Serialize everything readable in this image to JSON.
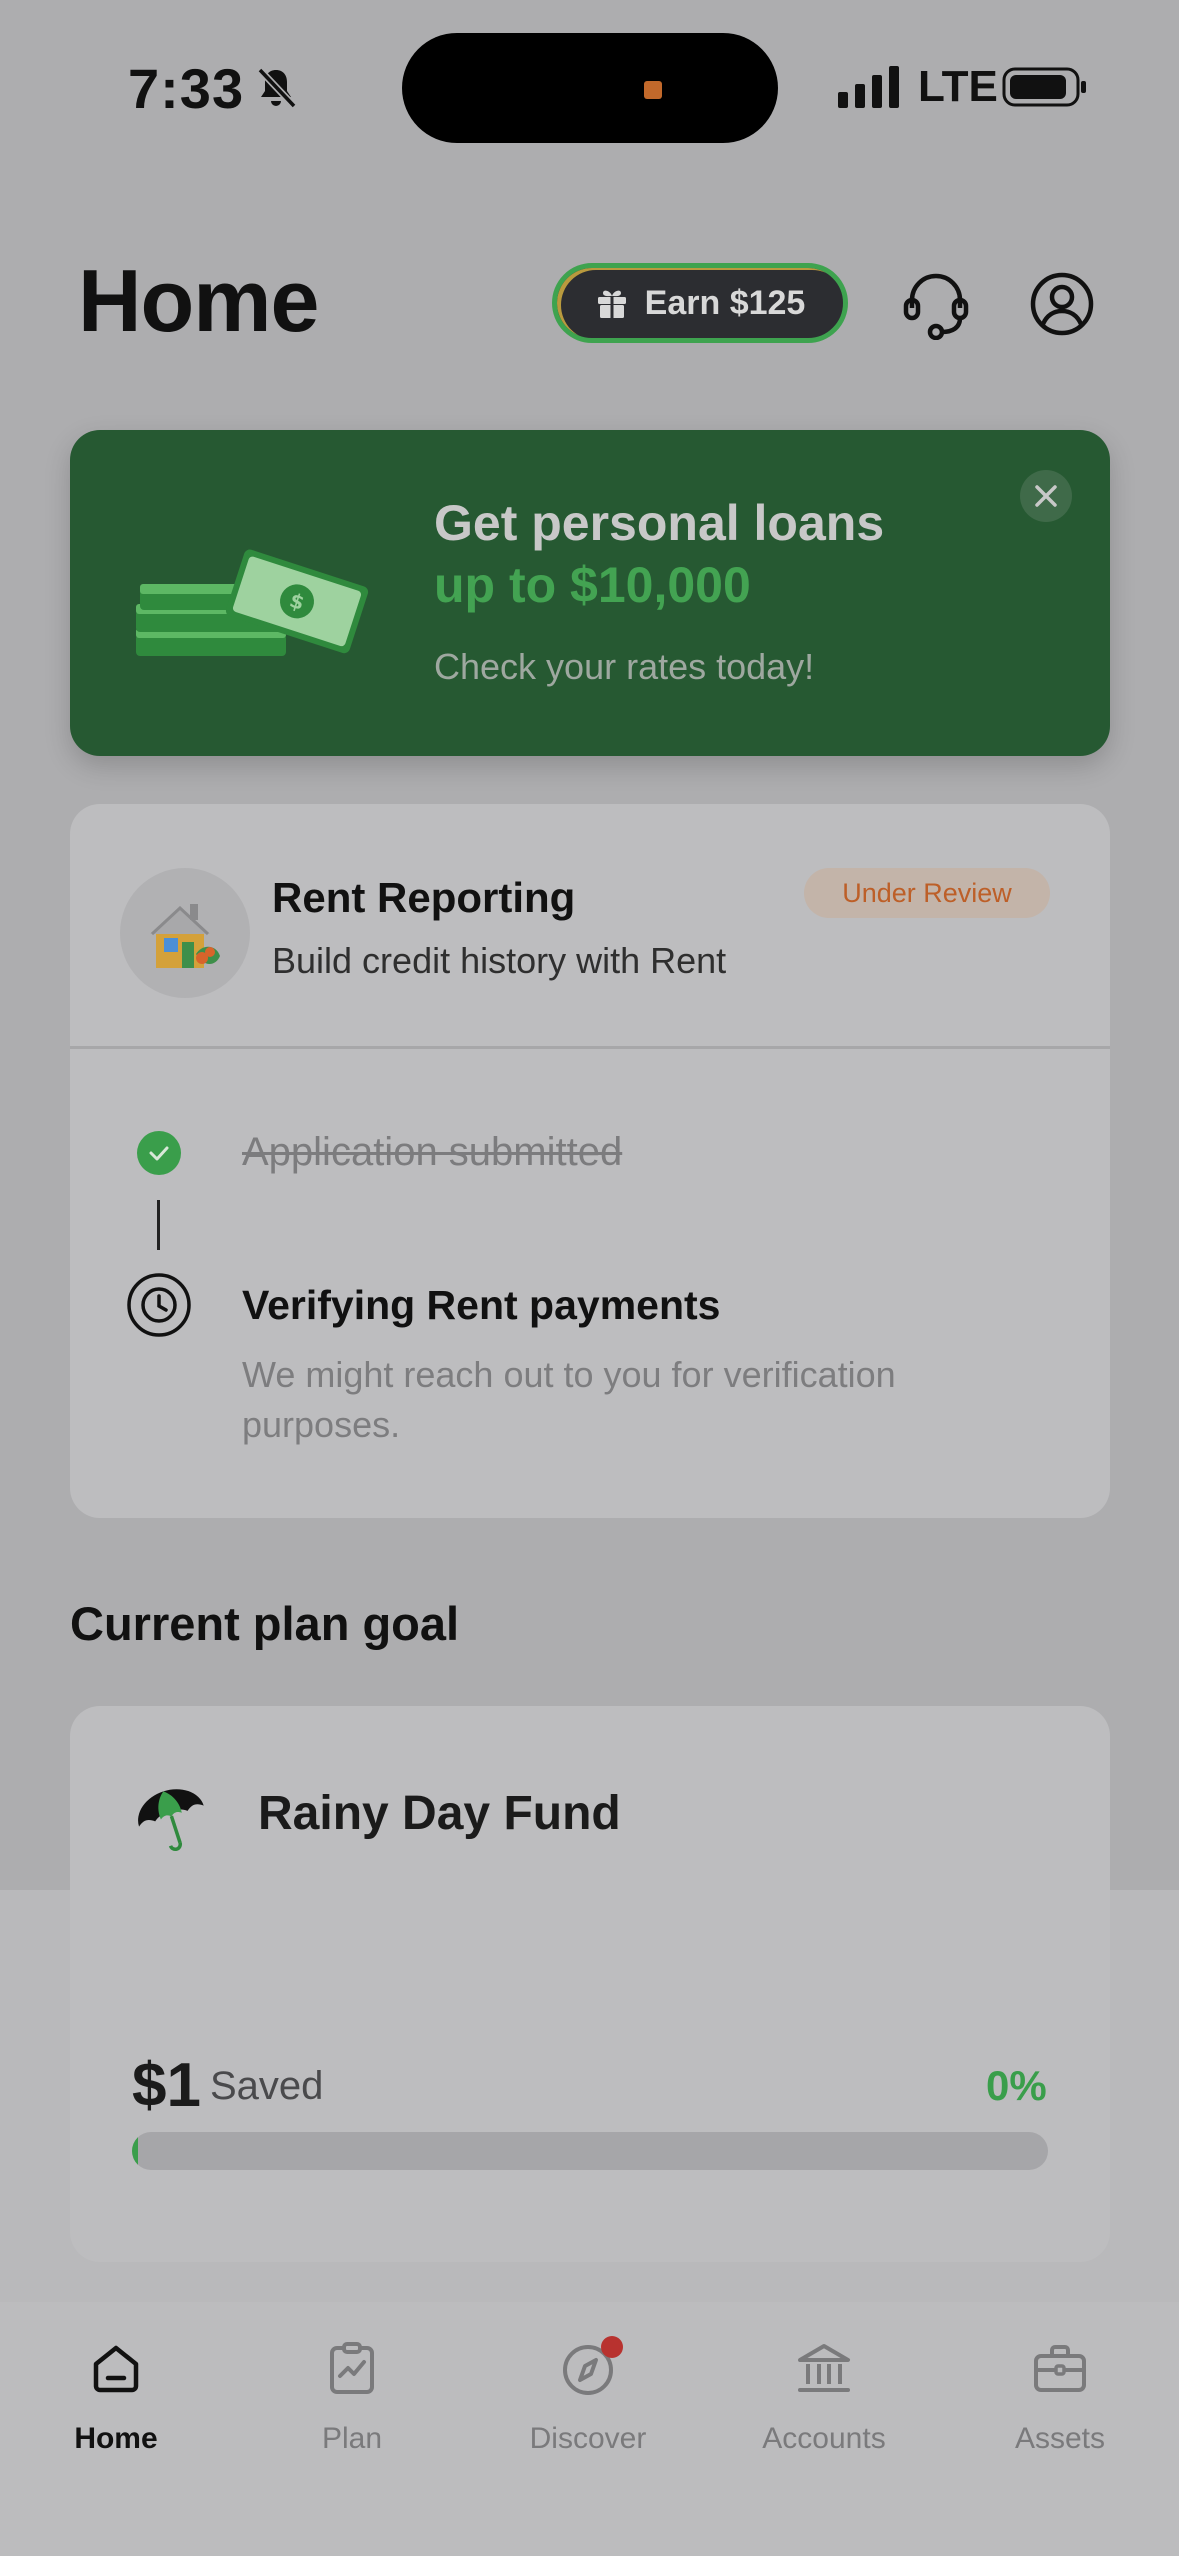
{
  "status_bar": {
    "time": "7:33",
    "network": "LTE",
    "icons": [
      "bell-slash-icon",
      "signal-icon",
      "battery-icon"
    ]
  },
  "header": {
    "title": "Home",
    "earn_label": "Earn $125",
    "icons": [
      "gift-icon",
      "headset-icon",
      "profile-icon"
    ]
  },
  "loan_banner": {
    "title": "Get personal loans",
    "amount": "up to $10,000",
    "subtitle": "Check your rates today!",
    "icons": [
      "money-stack-icon",
      "close-icon"
    ]
  },
  "rent_reporting": {
    "title": "Rent Reporting",
    "subtitle": "Build credit history with Rent",
    "status": "Under Review",
    "steps": [
      {
        "label": "Application submitted",
        "state": "done"
      },
      {
        "label": "Verifying Rent payments",
        "state": "in-progress",
        "description": "We might reach out to you for verification purposes."
      }
    ]
  },
  "plan_goal": {
    "section_title": "Current plan goal",
    "goal_name": "Rainy Day Fund",
    "saved_amount": "$1",
    "saved_label": "Saved",
    "percent_label": "0%",
    "progress_fraction": 0.006
  },
  "bottom_nav": {
    "items": [
      {
        "label": "Home",
        "icon": "home-icon",
        "active": true
      },
      {
        "label": "Plan",
        "icon": "clipboard-chart-icon",
        "active": false
      },
      {
        "label": "Discover",
        "icon": "compass-icon",
        "active": false,
        "badge": true
      },
      {
        "label": "Accounts",
        "icon": "bank-icon",
        "active": false
      },
      {
        "label": "Assets",
        "icon": "briefcase-icon",
        "active": false
      }
    ]
  },
  "colors": {
    "brand_green": "#3a9e4b",
    "banner_green": "#265932",
    "badge_orange": "#bd5f28",
    "notification_red": "#b8322f"
  }
}
